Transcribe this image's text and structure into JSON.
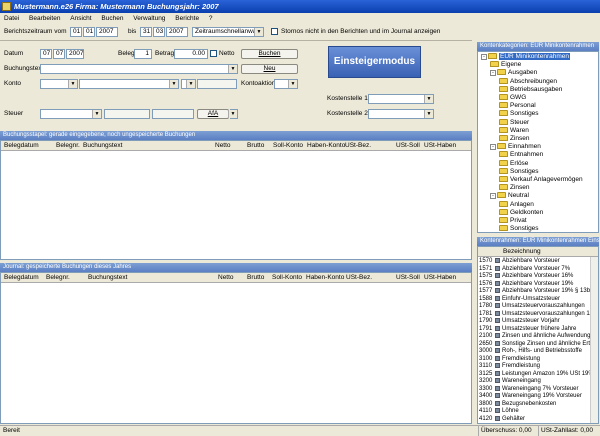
{
  "window": {
    "title": "Mustermann.e26  Firma: Mustermann  Buchungsjahr: 2007"
  },
  "menu": [
    "Datei",
    "Bearbeiten",
    "Ansicht",
    "Buchen",
    "Verwaltung",
    "Berichte",
    "?"
  ],
  "period": {
    "label_from": "Berichtszeitraum vom",
    "from_day": "01",
    "from_month": "01",
    "from_year": "2007",
    "label_to": "bis",
    "to_day": "31",
    "to_month": "03",
    "to_year": "2007",
    "quick_select": "Zeitraumschnellanwahl",
    "storno_label": "Stornos nicht in den Berichten und im Journal anzeigen"
  },
  "form": {
    "datum_label": "Datum",
    "date_day": "07",
    "date_month": "07",
    "date_year": "2007",
    "beleg_label": "Beleg",
    "beleg_value": "1",
    "betrag_label": "Betrag",
    "betrag_value": "0.00",
    "netto_label": "Netto",
    "buchen_button": "Buchen",
    "neu_button": "Neu",
    "buchungstext_label": "Buchungstext",
    "konto_label": "Konto",
    "kontoaktion_label": "Kontoaktion",
    "kostenstelle1_label": "Kostenstelle 1",
    "kostenstelle2_label": "Kostenstelle 2",
    "steuer_label": "Steuer",
    "afa_button": "AfA",
    "einsteiger_button": "Einsteigermodus"
  },
  "stapel": {
    "header": "Buchungsstapel: gerade eingegebene, noch ungespeicherte Buchungen",
    "columns": [
      "Belegdatum",
      "Belegnr.",
      "Buchungstext",
      "Netto",
      "Brutto",
      "Soll-Konto",
      "Haben-Konto",
      "USt-Bez.",
      "USt-Soll",
      "USt-Haben"
    ]
  },
  "journal": {
    "header": "Journal: gespeicherte Buchungen dieses Jahres",
    "columns": [
      "Belegdatum",
      "Belegnr.",
      "Buchungstext",
      "Netto",
      "Brutto",
      "Soll-Konto",
      "Haben-Konto",
      "USt-Bez.",
      "USt-Soll",
      "USt-Haben"
    ]
  },
  "tree": {
    "header": "Kontenkategorien: EUR Minikontenrahmen",
    "nodes": [
      {
        "label": "EUR Minikontenrahmen",
        "level": 0,
        "expander": "-"
      },
      {
        "label": "Eigene",
        "level": 1,
        "expander": ""
      },
      {
        "label": "Ausgaben",
        "level": 1,
        "expander": "-"
      },
      {
        "label": "Abschreibungen",
        "level": 2,
        "expander": ""
      },
      {
        "label": "Betriebsausgaben",
        "level": 2,
        "expander": ""
      },
      {
        "label": "GWG",
        "level": 2,
        "expander": ""
      },
      {
        "label": "Personal",
        "level": 2,
        "expander": ""
      },
      {
        "label": "Sonstiges",
        "level": 2,
        "expander": ""
      },
      {
        "label": "Steuer",
        "level": 2,
        "expander": ""
      },
      {
        "label": "Waren",
        "level": 2,
        "expander": ""
      },
      {
        "label": "Zinsen",
        "level": 2,
        "expander": ""
      },
      {
        "label": "Einnahmen",
        "level": 1,
        "expander": "-"
      },
      {
        "label": "Entnahmen",
        "level": 2,
        "expander": ""
      },
      {
        "label": "Erlöse",
        "level": 2,
        "expander": ""
      },
      {
        "label": "Sonstiges",
        "level": 2,
        "expander": ""
      },
      {
        "label": "Verkauf Anlagevermögen",
        "level": 2,
        "expander": ""
      },
      {
        "label": "Zinsen",
        "level": 2,
        "expander": ""
      },
      {
        "label": "Neutral",
        "level": 1,
        "expander": "-"
      },
      {
        "label": "Anlagen",
        "level": 2,
        "expander": ""
      },
      {
        "label": "Geldkonten",
        "level": 2,
        "expander": ""
      },
      {
        "label": "Privat",
        "level": 2,
        "expander": ""
      },
      {
        "label": "Sonstiges",
        "level": 2,
        "expander": ""
      }
    ]
  },
  "accounts": {
    "header": "Kontenrahmen: EUR Minikontenrahmen   Einstellungen",
    "column": "Bezeichnung",
    "rows": [
      {
        "num": "1570",
        "name": "Abziehbare Vorsteuer"
      },
      {
        "num": "1571",
        "name": "Abziehbare Vorsteuer 7%"
      },
      {
        "num": "1575",
        "name": "Abziehbare Vorsteuer 16%"
      },
      {
        "num": "1576",
        "name": "Abziehbare Vorsteuer 19%"
      },
      {
        "num": "1577",
        "name": "Abziehbare Vorsteuer 19% § 13b US"
      },
      {
        "num": "1588",
        "name": "Einfuhr-Umsatzsteuer"
      },
      {
        "num": "1780",
        "name": "Umsatzsteuervorauszahlungen"
      },
      {
        "num": "1781",
        "name": "Umsatzsteuervorauszahlungen 1/11"
      },
      {
        "num": "1790",
        "name": "Umsatzsteuer Vorjahr"
      },
      {
        "num": "1791",
        "name": "Umsatzsteuer frühere Jahre"
      },
      {
        "num": "2100",
        "name": "Zinsen und ähnliche Aufwendungen"
      },
      {
        "num": "2650",
        "name": "Sonstige Zinsen und ähnliche Erträge"
      },
      {
        "num": "3000",
        "name": "Roh-, Hilfs- und Betriebsstoffe"
      },
      {
        "num": "3100",
        "name": "Fremdleistung"
      },
      {
        "num": "3110",
        "name": "Fremdleistung"
      },
      {
        "num": "3125",
        "name": "Leistungen Amazon 19% USt 19% V"
      },
      {
        "num": "3200",
        "name": "Wareneingang"
      },
      {
        "num": "3300",
        "name": "Wareneingang 7% Vorsteuer"
      },
      {
        "num": "3400",
        "name": "Wareneingang 19% Vorsteuer"
      },
      {
        "num": "3800",
        "name": "Bezugsnebenkosten"
      },
      {
        "num": "4110",
        "name": "Löhne"
      },
      {
        "num": "4120",
        "name": "Gehälter"
      }
    ]
  },
  "status": {
    "left": "Bereit",
    "ueberschuss": "Überschuss: 0,00",
    "ust_zahllast": "USt-Zahllast: 0,00"
  }
}
